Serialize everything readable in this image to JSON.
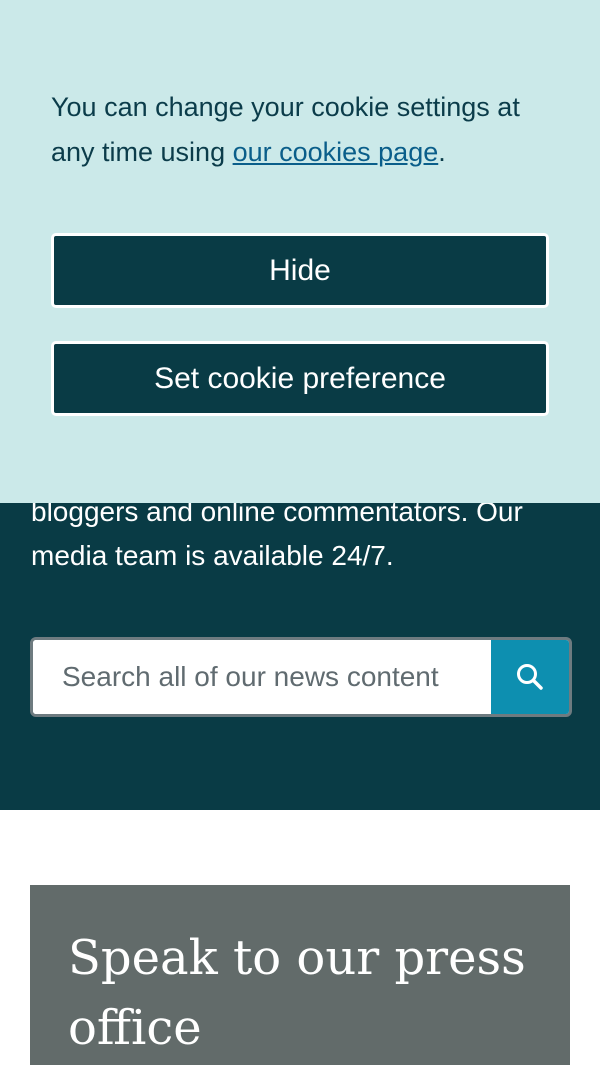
{
  "cookie_banner": {
    "message_before_link": "You can change your cookie settings at any time using ",
    "link_text": "our cookies page",
    "message_after_link": ".",
    "hide_label": "Hide",
    "preference_label": "Set cookie preference"
  },
  "hero": {
    "text": "bloggers and online commentators. Our media team is available 24/7."
  },
  "search": {
    "placeholder": "Search all of our news content",
    "button_icon": "search-icon"
  },
  "press_card": {
    "title": "Speak to our press office"
  },
  "colors": {
    "banner_bg": "#cbe9e9",
    "dark_teal": "#093b45",
    "search_accent": "#0d8fb0",
    "card_gray": "#626b6a",
    "link": "#0a5e8a"
  }
}
